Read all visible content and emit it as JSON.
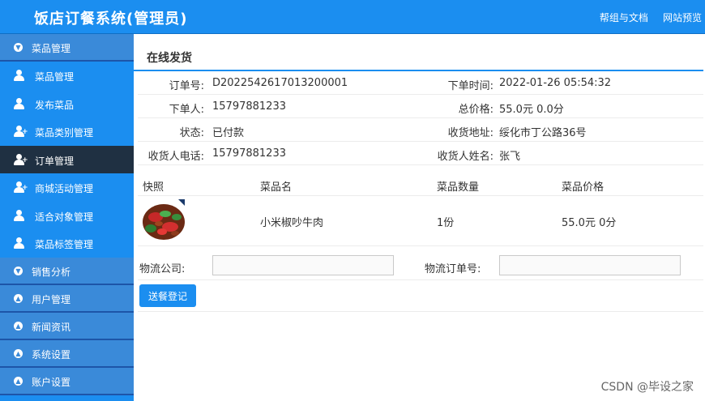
{
  "header": {
    "title": "饭店订餐系统(管理员)",
    "links": [
      "帮组与文档",
      "网站预览"
    ]
  },
  "sidebar": {
    "groups": [
      {
        "label": "菜品管理",
        "icon": "chevron-down-circle-icon"
      },
      {
        "label": "销售分析",
        "icon": "chevron-down-circle-icon"
      },
      {
        "label": "用户管理",
        "icon": "chevron-up-circle-icon"
      },
      {
        "label": "新闻资讯",
        "icon": "chevron-up-circle-icon"
      },
      {
        "label": "系统设置",
        "icon": "chevron-up-circle-icon"
      },
      {
        "label": "账户设置",
        "icon": "chevron-up-circle-icon"
      }
    ],
    "items": [
      {
        "label": "菜品管理",
        "icon": "user-icon"
      },
      {
        "label": "发布菜品",
        "icon": "user-icon"
      },
      {
        "label": "菜品类别管理",
        "icon": "user-add-icon"
      },
      {
        "label": "订单管理",
        "icon": "user-add-icon"
      },
      {
        "label": "商城活动管理",
        "icon": "user-add-icon"
      },
      {
        "label": "适合对象管理",
        "icon": "user-icon"
      },
      {
        "label": "菜品标签管理",
        "icon": "user-icon"
      }
    ],
    "active_item": "订单管理"
  },
  "main": {
    "title": "在线发货",
    "order": {
      "order_no_label": "订单号:",
      "order_no": "D2022542617013200001",
      "order_time_label": "下单时间:",
      "order_time": "2022-01-26 05:54:32",
      "buyer_label": "下单人:",
      "buyer": "15797881233",
      "total_label": "总价格:",
      "total": "55.0元 0.0分",
      "status_label": "状态:",
      "status": "已付款",
      "address_label": "收货地址:",
      "address": "绥化市丁公路36号",
      "phone_label": "收货人电话:",
      "phone": "15797881233",
      "receiver_label": "收货人姓名:",
      "receiver": "张飞"
    },
    "table": {
      "headers": [
        "快照",
        "菜品名",
        "菜品数量",
        "菜品价格"
      ],
      "rows": [
        {
          "name": "小米椒吵牛肉",
          "qty": "1份",
          "price": "55.0元 0分"
        }
      ]
    },
    "shipping": {
      "company_label": "物流公司:",
      "company_value": "",
      "tracking_label": "物流订单号:",
      "tracking_value": "",
      "submit_label": "送餐登记"
    }
  },
  "watermark": "CSDN @毕设之家",
  "colors": {
    "primary": "#1b8ef0",
    "group_bg": "#3a8ad9",
    "active_bg": "#1f3042"
  }
}
